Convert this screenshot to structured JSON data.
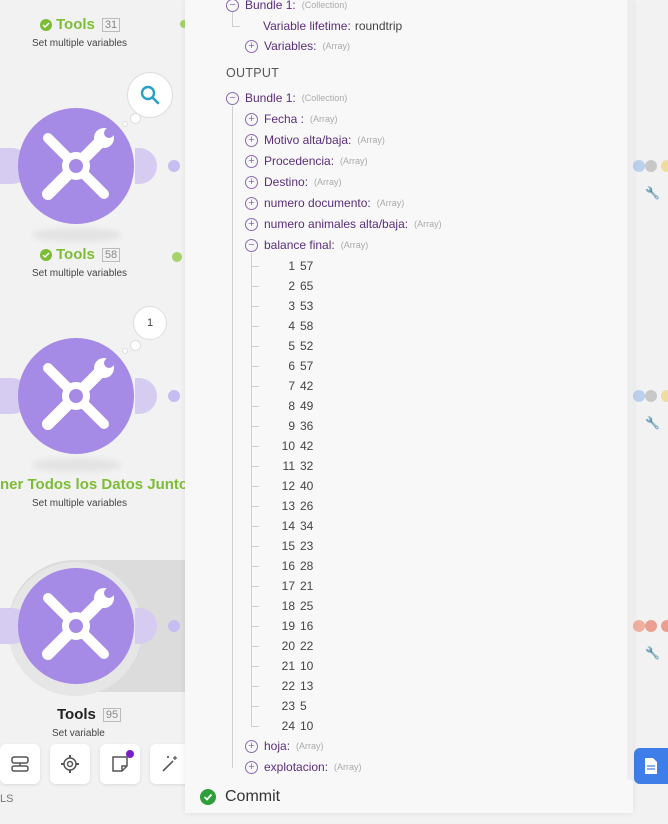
{
  "canvas": {
    "modules": [
      {
        "title": "Tools",
        "number": "31",
        "subtitle": "Set multiple variables"
      },
      {
        "title": "Tools",
        "number": "58",
        "subtitle": "Set multiple variables"
      },
      {
        "title": "ner Todos los Datos Juntos",
        "subtitle": "Set multiple variables",
        "bubble": "1"
      },
      {
        "title": "Tools",
        "number": "95",
        "subtitle": "Set variable"
      }
    ],
    "tools_label": "LS",
    "toolbar_icons": [
      "router-icon",
      "gear-icon",
      "notes-icon",
      "magic-wand-icon"
    ],
    "accent_color": "#a58ae6",
    "success_color": "#7dbd36"
  },
  "panel": {
    "input_bundle": {
      "label": "Bundle 1:",
      "type": "(Collection)"
    },
    "variable_lifetime": {
      "key": "Variable lifetime:",
      "value": "roundtrip"
    },
    "variables": {
      "key": "Variables:",
      "type": "(Array)"
    },
    "output_title": "OUTPUT",
    "output_bundle": {
      "label": "Bundle 1:",
      "type": "(Collection)"
    },
    "fields": [
      {
        "key": "Fecha :",
        "type": "(Array)"
      },
      {
        "key": "Motivo alta/baja:",
        "type": "(Array)"
      },
      {
        "key": "Procedencia:",
        "type": "(Array)"
      },
      {
        "key": "Destino:",
        "type": "(Array)"
      },
      {
        "key": "numero documento:",
        "type": "(Array)"
      },
      {
        "key": "numero animales alta/baja:",
        "type": "(Array)"
      }
    ],
    "balance": {
      "key": "balance final:",
      "type": "(Array)"
    },
    "balance_items": [
      {
        "i": "1",
        "v": "57"
      },
      {
        "i": "2",
        "v": "65"
      },
      {
        "i": "3",
        "v": "53"
      },
      {
        "i": "4",
        "v": "58"
      },
      {
        "i": "5",
        "v": "52"
      },
      {
        "i": "6",
        "v": "57"
      },
      {
        "i": "7",
        "v": "42"
      },
      {
        "i": "8",
        "v": "49"
      },
      {
        "i": "9",
        "v": "36"
      },
      {
        "i": "10",
        "v": "42"
      },
      {
        "i": "11",
        "v": "32"
      },
      {
        "i": "12",
        "v": "40"
      },
      {
        "i": "13",
        "v": "26"
      },
      {
        "i": "14",
        "v": "34"
      },
      {
        "i": "15",
        "v": "23"
      },
      {
        "i": "16",
        "v": "28"
      },
      {
        "i": "17",
        "v": "21"
      },
      {
        "i": "18",
        "v": "25"
      },
      {
        "i": "19",
        "v": "16"
      },
      {
        "i": "20",
        "v": "22"
      },
      {
        "i": "21",
        "v": "10"
      },
      {
        "i": "22",
        "v": "13"
      },
      {
        "i": "23",
        "v": "5"
      },
      {
        "i": "24",
        "v": "10"
      }
    ],
    "after_fields": [
      {
        "key": "hoja:",
        "type": "(Array)"
      },
      {
        "key": "explotacion:",
        "type": "(Array)"
      }
    ],
    "commit_label": "Commit"
  }
}
